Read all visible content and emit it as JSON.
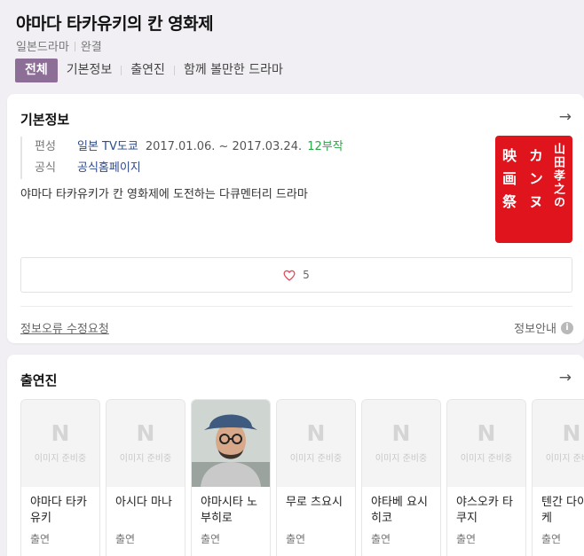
{
  "header": {
    "title": "야마다 타카유키의 칸 영화제",
    "genre": "일본드라마",
    "status": "완결",
    "tabs": [
      {
        "label": "전체"
      },
      {
        "label": "기본정보"
      },
      {
        "label": "출연진"
      },
      {
        "label": "함께 볼만한 드라마"
      }
    ]
  },
  "basic_info": {
    "section_title": "기본정보",
    "arrow": "→",
    "broadcast_label": "편성",
    "broadcaster": "일본 TV도쿄",
    "dates": "2017.01.06. ~ 2017.03.24.",
    "episodes": "12부작",
    "official_label": "공식",
    "official_link": "공식홈페이지",
    "description": "야마다 타카유키가 칸 영화제에 도전하는 다큐멘터리 드라마",
    "poster_text": {
      "col1": "山田孝之の",
      "col2": "カンヌ",
      "col3": "映画祭"
    },
    "like_count": "5",
    "report_link": "정보오류 수정요청",
    "guide_label": "정보안내",
    "guide_icon_glyph": "i",
    "colors": {
      "accent": "#8c6e97",
      "poster": "#e0141d",
      "episodes": "#27a745",
      "heart": "#e14a5b"
    }
  },
  "cast": {
    "section_title": "출연진",
    "arrow": "→",
    "placeholder_letter": "N",
    "placeholder_text": "이미지 준비중",
    "members": [
      {
        "name": "야마다 타카유키",
        "role": "출연",
        "has_photo": false
      },
      {
        "name": "아시다 마나",
        "role": "출연",
        "has_photo": false
      },
      {
        "name": "야마시타 노부히로",
        "role": "출연",
        "has_photo": true
      },
      {
        "name": "무로 츠요시",
        "role": "출연",
        "has_photo": false
      },
      {
        "name": "야타베 요시히코",
        "role": "출연",
        "has_photo": false
      },
      {
        "name": "야스오카 타쿠지",
        "role": "출연",
        "has_photo": false
      },
      {
        "name": "텐간 다이스케",
        "role": "출연",
        "has_photo": false
      }
    ]
  }
}
